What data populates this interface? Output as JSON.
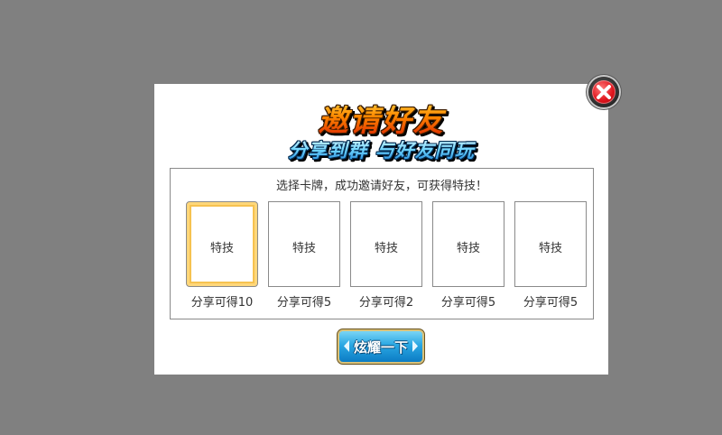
{
  "dialog": {
    "title": "邀请好友",
    "subtitle": "分享到群  与好友同玩",
    "instruction": "选择卡牌，成功邀请好友，可获得特技！",
    "cards": [
      {
        "label": "特技",
        "reward": "分享可得10",
        "selected": true
      },
      {
        "label": "特技",
        "reward": "分享可得5",
        "selected": false
      },
      {
        "label": "特技",
        "reward": "分享可得2",
        "selected": false
      },
      {
        "label": "特技",
        "reward": "分享可得5",
        "selected": false
      },
      {
        "label": "特技",
        "reward": "分享可得5",
        "selected": false
      }
    ],
    "button_label": "炫耀一下",
    "close_icon": "close-icon"
  },
  "colors": {
    "overlay": "#808080",
    "dialog_bg": "#ffffff",
    "title_gradient": [
      "#ffe04a",
      "#ff8a00",
      "#d91a00"
    ],
    "subtitle_gradient": [
      "#e8fbff",
      "#6fd6ff",
      "#1a7fd6"
    ],
    "button": "#2aa7e3",
    "selected_card_border": "#f6c250"
  }
}
